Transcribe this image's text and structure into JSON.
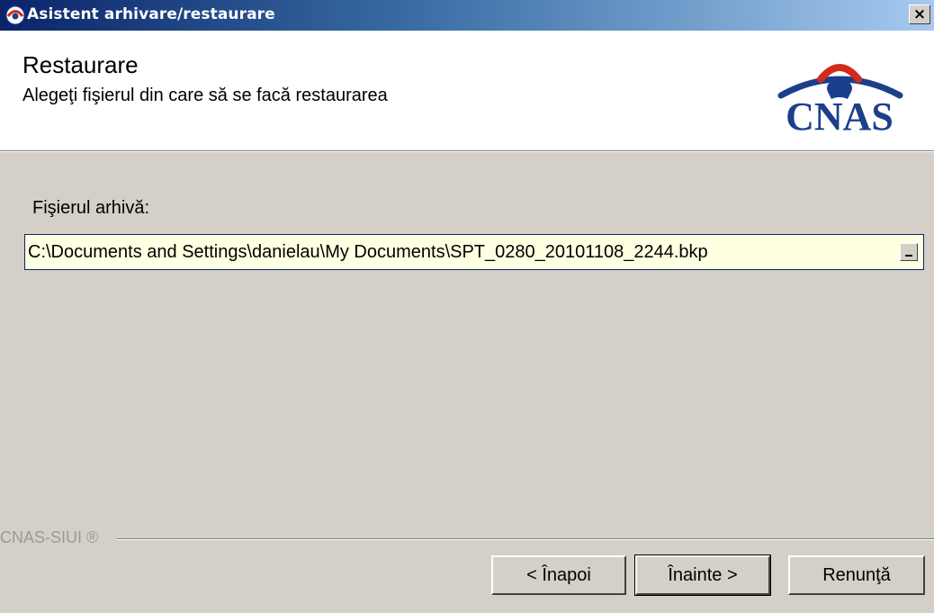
{
  "window": {
    "title": "Asistent arhivare/restaurare",
    "close_glyph": "×"
  },
  "header": {
    "title": "Restaurare",
    "subtitle": "Alegeţi fişierul din care să se facă restaurarea",
    "logo_text": "CNAS",
    "logo_icon": "cnas-logo-icon"
  },
  "form": {
    "file_label": "Fişierul arhivă:",
    "file_value": "C:\\Documents and Settings\\danielau\\My Documents\\SPT_0280_20101108_2244.bkp",
    "browse_icon": "ellipsis-browse-icon"
  },
  "footer": {
    "brand": "CNAS-SIUI ®"
  },
  "buttons": {
    "back": "< Înapoi",
    "next": "Înainte >",
    "cancel": "Renunţă"
  },
  "colors": {
    "titlebar_start": "#0a246a",
    "titlebar_end": "#a6caf0",
    "dialog_bg": "#d4d0c8",
    "field_bg": "#ffffe1",
    "logo_blue": "#1c3f8c",
    "logo_red": "#d42a1c"
  }
}
